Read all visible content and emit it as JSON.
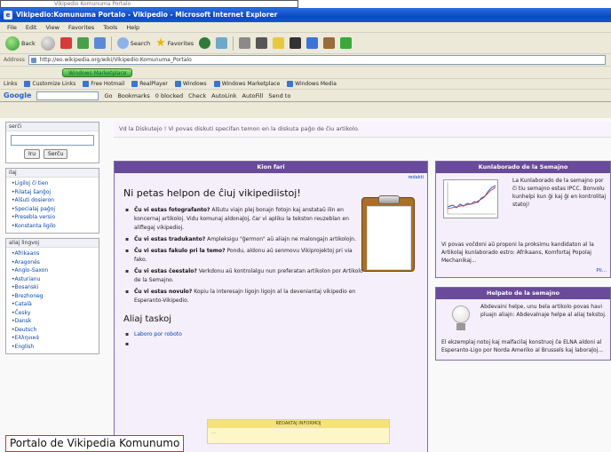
{
  "top_caption": "Vikipedio Komunuma Portalo",
  "window": {
    "title": "Vikipedio:Komunuma Portalo - Vikipedio - Microsoft Internet Explorer",
    "menu": [
      "File",
      "Edit",
      "View",
      "Favorites",
      "Tools",
      "Help"
    ],
    "toolbar": {
      "back": "Back",
      "search": "Search",
      "favorites": "Favorites"
    },
    "address_label": "Address",
    "address": "http://eo.wikipedia.org/wiki/Vikipedio:Komunuma_Portalo",
    "green_button": "Windows Marketplace",
    "links_label": "Links",
    "links": [
      "Customize Links",
      "Free Hotmail",
      "RealPlayer",
      "Windows",
      "Windows Marketplace",
      "Windows Media"
    ],
    "google": {
      "logo": "Google",
      "bar_items": [
        "Go",
        "Bookmarks",
        "0 blocked",
        "Check",
        "AutoLink",
        "AutoFill",
        "Send to"
      ]
    }
  },
  "sidebar": {
    "search_header": "serĉi",
    "search_buttons": [
      "Iru",
      "Serĉu"
    ],
    "tools_header": "ilaj",
    "tools": [
      "Ligiloj ĉi tien",
      "Rilataj ŝanĝoj",
      "Alŝuti dosieron",
      "Specialaj paĝoj",
      "Presebla versio",
      "Konstanta ligilo"
    ],
    "lang_header": "aliaj lingvoj",
    "languages": [
      "Afrikaans",
      "Aragonés",
      "Anglo-Saxon",
      "Asturianu",
      "Bosanski",
      "Brezhoneg",
      "Català",
      "Česky",
      "Dansk",
      "Deutsch",
      "Ελληνικά",
      "English"
    ]
  },
  "notice": "Vd la Diskutejo ! Vi povas diskuti specifan temon en la diskuta paĝo de ĉiu artikolo.",
  "main": {
    "bar": "Kion fari",
    "sublink": "redakti",
    "heading": "Ni petas helpon de ĉiuj vikipediistoj!",
    "tips": [
      {
        "lead": "Ĉu vi estas fotografanto?",
        "text": " Alŝutu viajn plej bonajn fotojn kaj anstataŭ ilin en koncernaj artikoloj. Vidu komunaj aldonaĵoj, ĉar vi apliku la tekston reuzeblan en aliflegaj vikipedioj."
      },
      {
        "lead": "Ĉu vi estas tradukanto?",
        "text": " Ampleksigu \"ĝermon\" aŭ aliajn ne malongajn artikolojn."
      },
      {
        "lead": "Ĉu vi estas fakulo pri la temo?",
        "text": " Pondu, aldonu aŭ senmovu Vikiprojektoj pri via fako."
      },
      {
        "lead": "Ĉu vi estas ĉeestalo?",
        "text": " Verkdonu aŭ kontrolalgu nun preferatan artikolon por Artikolo de la Semajno."
      },
      {
        "lead": "Ĉu vi estas novulo?",
        "text": " Kopiu la interesajn ligojn ligojn al la deveniantaj vikipedio en Esperanto-Vikipedio."
      }
    ],
    "subheading": "Aliaj taskoj",
    "subitems": [
      "Laboro por roboto",
      ""
    ],
    "yellow_bar": "REDAKTAJ INFORMOJ",
    "yellow_text": "…"
  },
  "right": {
    "box1": {
      "bar": "Kunlaborado de la Semajno",
      "text": "La Kunlaborado de la semajno por ĉi tiu semajno estas IPCC. Bonvolu kunhelpi kun ĝi kaj ĝi en kontrolitaj statoj!",
      "foot": "Vi povas voĉdoni aŭ proponi la proksimu kandidaton al la Artikolaj kunlaborado estro: Afrikaans, Komfortaj Popolaj Mechanikaj...",
      "more": "Pli..."
    },
    "box2": {
      "bar": "Helpato de la semajno",
      "text": "Abdevaini helpe, unu bela artikolo povas havi pluajn aliajn: Abdevalnaje helpe al aliaj tekstoj.",
      "foot": "El ekzemplaj notoj kaj malfacilaj konstruoj ĉe ELNA aldoni al Esperanto-Ligo por Norda Ameriko al Brussels kaj laboraĵoj..."
    }
  },
  "bottom_caption": "Portalo de Vikipedia Komunumo",
  "colors": {
    "purple_bar": "#6a4a9a",
    "panel_bg": "#f4effa",
    "link": "#0645ad",
    "titlebar": "#0c47c4"
  },
  "icons": [
    "back-icon",
    "forward-icon",
    "stop-icon",
    "refresh-icon",
    "home-icon",
    "search-icon",
    "favorites-icon",
    "media-icon",
    "history-icon",
    "mail-icon",
    "print-icon",
    "clipboard-icon",
    "lightbulb-icon",
    "chart-thumbnail"
  ]
}
